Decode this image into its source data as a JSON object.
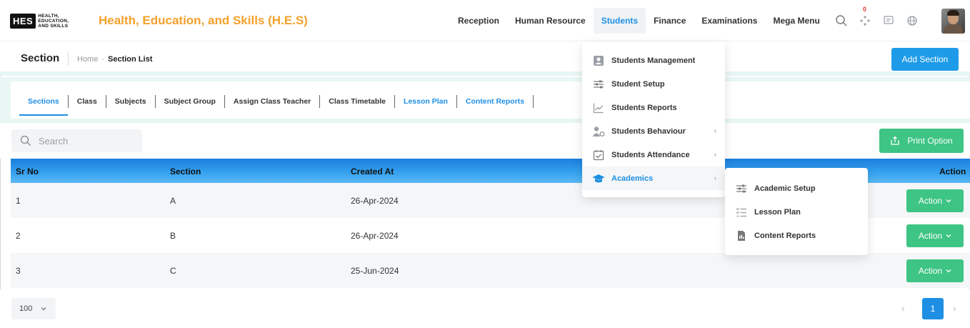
{
  "brand": {
    "logo_abbr": "HES",
    "logo_text": [
      "HEALTH,",
      "EDUCATION,",
      "AND SKILLS"
    ],
    "title": "Health, Education, and Skills (H.E.S)",
    "color": "#f2a12b"
  },
  "nav": {
    "items": [
      {
        "label": "Reception"
      },
      {
        "label": "Human Resource"
      },
      {
        "label": "Students",
        "active": true
      },
      {
        "label": "Finance"
      },
      {
        "label": "Examinations"
      },
      {
        "label": "Mega Menu"
      }
    ],
    "notification_count": "0",
    "icons": [
      "search-icon",
      "apps-icon",
      "message-icon",
      "globe-icon"
    ]
  },
  "page": {
    "title": "Section",
    "breadcrumb": {
      "home": "Home",
      "sep": "-",
      "current": "Section List"
    },
    "add_button": "Add Section"
  },
  "tabs": [
    {
      "label": "Sections",
      "active": true
    },
    {
      "label": "Class"
    },
    {
      "label": "Subjects"
    },
    {
      "label": "Subject Group"
    },
    {
      "label": "Assign Class Teacher"
    },
    {
      "label": "Class Timetable"
    },
    {
      "label": "Lesson Plan",
      "blue": true
    },
    {
      "label": "Content Reports",
      "blue": true
    }
  ],
  "toolbar": {
    "search_placeholder": "Search",
    "print_button": "Print Option"
  },
  "table": {
    "columns": [
      "Sr No",
      "Section",
      "Created At",
      "Action"
    ],
    "rows": [
      {
        "sr": "1",
        "section": "A",
        "created": "26-Apr-2024",
        "action": "Action"
      },
      {
        "sr": "2",
        "section": "B",
        "created": "26-Apr-2024",
        "action": "Action"
      },
      {
        "sr": "3",
        "section": "C",
        "created": "25-Jun-2024",
        "action": "Action"
      }
    ]
  },
  "footer": {
    "page_size": "100",
    "current_page": "1"
  },
  "students_menu": {
    "items": [
      {
        "label": "Students Management",
        "icon": "students-management-icon"
      },
      {
        "label": "Student Setup",
        "icon": "sliders-icon"
      },
      {
        "label": "Students Reports",
        "icon": "chart-icon"
      },
      {
        "label": "Students Behaviour",
        "icon": "user-gear-icon",
        "submenu": true
      },
      {
        "label": "Students Attendance",
        "icon": "calendar-check-icon",
        "submenu": true
      },
      {
        "label": "Academics",
        "icon": "graduation-cap-icon",
        "submenu": true,
        "active": true
      }
    ]
  },
  "academics_menu": {
    "items": [
      {
        "label": "Academic Setup",
        "icon": "sliders-icon"
      },
      {
        "label": "Lesson Plan",
        "icon": "checklist-icon"
      },
      {
        "label": "Content Reports",
        "icon": "document-icon"
      }
    ]
  },
  "colors": {
    "primary": "#1e8fe3",
    "success": "#3ec484",
    "accent_bg": "#e9f6f3"
  }
}
